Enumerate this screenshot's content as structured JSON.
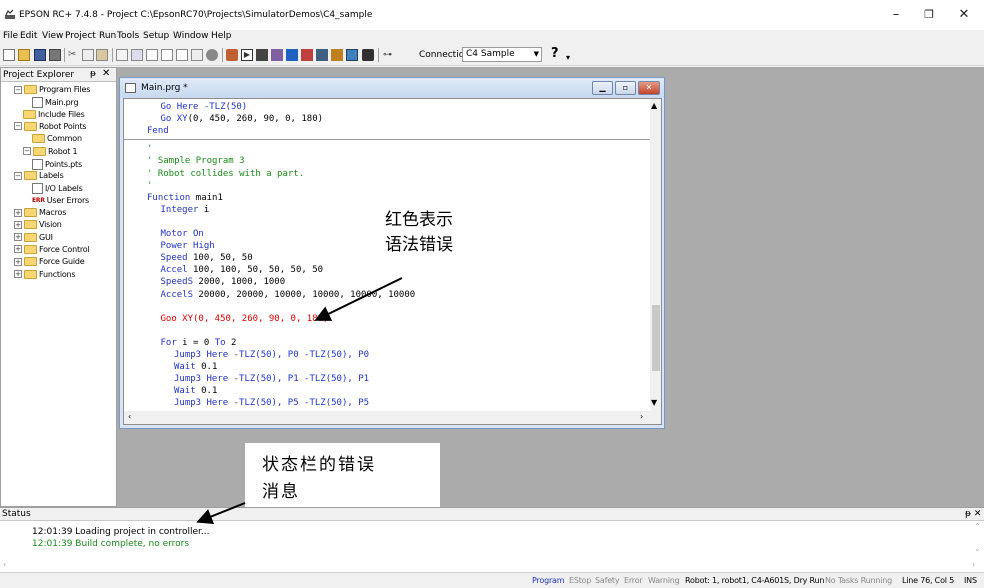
{
  "window": {
    "title": "EPSON RC+ 7.4.8 - Project C:\\EpsonRC70\\Projects\\SimulatorDemos\\C4_sample",
    "minimize": "–",
    "maximize": "❐",
    "close": "✕"
  },
  "menu": [
    "File",
    "Edit",
    "View",
    "Project",
    "Run",
    "Tools",
    "Setup",
    "Window",
    "Help"
  ],
  "toolbar": {
    "connection_label": "Connection:",
    "connection_value": "C4 Sample",
    "help": "?"
  },
  "explorer": {
    "title": "Project Explorer",
    "pin": "ᵽ",
    "close": "✕",
    "items": [
      {
        "label": "Program Files",
        "kind": "folder",
        "expand": "−"
      },
      {
        "label": "Main.prg",
        "kind": "file",
        "expand": ""
      },
      {
        "label": "Include Files",
        "kind": "folder",
        "expand": ""
      },
      {
        "label": "Robot Points",
        "kind": "folder",
        "expand": "−"
      },
      {
        "label": "Common",
        "kind": "folder",
        "expand": ""
      },
      {
        "label": "Robot 1",
        "kind": "folder",
        "expand": "−"
      },
      {
        "label": "Points.pts",
        "kind": "file",
        "expand": ""
      },
      {
        "label": "Labels",
        "kind": "folder",
        "expand": "−"
      },
      {
        "label": "I/O Labels",
        "kind": "file",
        "expand": ""
      },
      {
        "label": "User Errors",
        "kind": "err",
        "expand": ""
      },
      {
        "label": "Macros",
        "kind": "folder",
        "expand": "+"
      },
      {
        "label": "Vision",
        "kind": "folder",
        "expand": "+"
      },
      {
        "label": "GUI",
        "kind": "folder",
        "expand": "+"
      },
      {
        "label": "Force Control",
        "kind": "folder",
        "expand": "+"
      },
      {
        "label": "Force Guide",
        "kind": "folder",
        "expand": "+"
      },
      {
        "label": "Functions",
        "kind": "folder",
        "expand": "+"
      }
    ]
  },
  "editor": {
    "title": "Main.prg *",
    "lines": [
      {
        "indent": 3,
        "parts": [
          [
            "kw",
            "Go Here -TLZ(50)"
          ]
        ]
      },
      {
        "indent": 3,
        "parts": [
          [
            "kw",
            "Go XY"
          ],
          [
            "txt",
            "(0, 450, 260, 90, 0, 180)"
          ]
        ]
      },
      {
        "indent": 0,
        "parts": [
          [
            "kw",
            "Fend"
          ]
        ]
      },
      {
        "sep": true
      },
      {
        "indent": 0,
        "parts": [
          [
            "cmt",
            "'"
          ]
        ]
      },
      {
        "indent": 0,
        "parts": [
          [
            "cmt",
            "' Sample Program 3"
          ]
        ]
      },
      {
        "indent": 0,
        "parts": [
          [
            "cmt",
            "' Robot collides with a part."
          ]
        ]
      },
      {
        "indent": 0,
        "parts": [
          [
            "cmt",
            "'"
          ]
        ]
      },
      {
        "indent": 0,
        "parts": [
          [
            "kw",
            "Function"
          ],
          [
            "txt",
            " main1"
          ]
        ]
      },
      {
        "indent": 3,
        "parts": [
          [
            "kw",
            "Integer"
          ],
          [
            "txt",
            " i"
          ]
        ]
      },
      {
        "indent": 0,
        "parts": []
      },
      {
        "indent": 3,
        "parts": [
          [
            "kw",
            "Motor On"
          ]
        ]
      },
      {
        "indent": 3,
        "parts": [
          [
            "kw",
            "Power High"
          ]
        ]
      },
      {
        "indent": 3,
        "parts": [
          [
            "kw",
            "Speed"
          ],
          [
            "txt",
            " 100, 50, 50"
          ]
        ]
      },
      {
        "indent": 3,
        "parts": [
          [
            "kw",
            "Accel"
          ],
          [
            "txt",
            " 100, 100, 50, 50, 50, 50"
          ]
        ]
      },
      {
        "indent": 3,
        "parts": [
          [
            "kw",
            "SpeedS"
          ],
          [
            "txt",
            " 2000, 1000, 1000"
          ]
        ]
      },
      {
        "indent": 3,
        "parts": [
          [
            "kw",
            "AccelS"
          ],
          [
            "txt",
            " 20000, 20000, 10000, 10000, 10000, 10000"
          ]
        ]
      },
      {
        "indent": 0,
        "parts": []
      },
      {
        "indent": 3,
        "parts": [
          [
            "err",
            "Goo XY(0, 450, 260, 90, 0, 180)"
          ]
        ]
      },
      {
        "indent": 0,
        "parts": []
      },
      {
        "indent": 3,
        "parts": [
          [
            "kw",
            "For"
          ],
          [
            "txt",
            " i = 0 "
          ],
          [
            "kw",
            "To"
          ],
          [
            "txt",
            " 2"
          ]
        ]
      },
      {
        "indent": 6,
        "parts": [
          [
            "kw",
            "Jump3 Here -TLZ(50), P0 -TLZ(50), P0"
          ]
        ]
      },
      {
        "indent": 6,
        "parts": [
          [
            "kw",
            "Wait"
          ],
          [
            "txt",
            " 0.1"
          ]
        ]
      },
      {
        "indent": 6,
        "parts": [
          [
            "kw",
            "Jump3 Here -TLZ(50), P1 -TLZ(50), P1"
          ]
        ]
      },
      {
        "indent": 6,
        "parts": [
          [
            "kw",
            "Wait"
          ],
          [
            "txt",
            " 0.1"
          ]
        ]
      },
      {
        "indent": 6,
        "parts": [
          [
            "kw",
            "Jump3 Here -TLZ(50), P5 -TLZ(50), P5"
          ]
        ]
      }
    ]
  },
  "annotations": {
    "syntax_error_line1": "红色表示",
    "syntax_error_line2": "语法错误",
    "status_error_line1": "状态栏的错误",
    "status_error_line2": "消息"
  },
  "status_panel": {
    "title": "Status",
    "pin": "ᵽ ✕",
    "messages": [
      {
        "text": "12:01:39 Loading project in controller...",
        "color": "#000000"
      },
      {
        "text": "12:01:39 Build complete, no errors",
        "color": "#1a8a1a"
      }
    ]
  },
  "status_bar": {
    "program": "Program",
    "estop": "EStop",
    "safety": "Safety",
    "error": "Error",
    "warning": "Warning",
    "robot": "Robot: 1, robot1, C4-A601S, Dry Run",
    "tasks": "No Tasks Running",
    "position": "Line 76, Col 5",
    "mode": "INS"
  },
  "colors": {
    "keyword": "#2233c8",
    "comment": "#1a8a1a",
    "error": "#e00000",
    "program_tab": "#2233c8"
  }
}
